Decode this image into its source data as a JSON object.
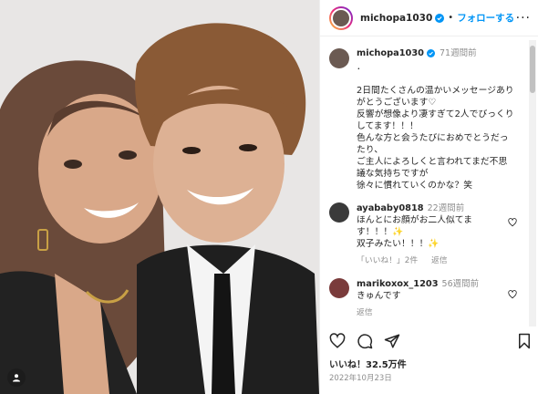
{
  "header": {
    "username": "michopa1030",
    "separator": "•",
    "follow_label": "フォローする",
    "more_label": "···"
  },
  "caption": {
    "username": "michopa1030",
    "time": "71週間前",
    "text": "．\n\n2日間たくさんの温かいメッセージあり\nがとうございます♡\n反響が想像より凄すぎて2人でびっくり\nしてます！！！\n色んな方と会うたびにおめでとうだっ\nたり、\nご主人によろしくと言われてまだ不思\n議な気持ちですが\n徐々に慣れていくのかな？笑"
  },
  "comments": [
    {
      "username": "ayababy0818",
      "time": "22週間前",
      "text": "ほんとにお顔がお二人似てま\nす！！！✨\n双子みたい！！！✨",
      "likes_label": "「いいね！」2件",
      "reply_label": "返信",
      "avatar_color": "#3a3a3a"
    },
    {
      "username": "marikoxox_1203",
      "time": "56週間前",
      "text": "きゅんです",
      "likes_label": "",
      "reply_label": "返信",
      "avatar_color": "#7a3b3b"
    }
  ],
  "footer": {
    "likes": "いいね！32.5万件",
    "date": "2022年10月23日"
  },
  "icons": {
    "like": "heart-icon",
    "comment": "comment-icon",
    "share": "share-icon",
    "save": "bookmark-icon",
    "verified": "verified-badge-icon",
    "tag": "tagged-user-icon"
  },
  "colors": {
    "follow": "#0095f6",
    "verified": "#0095f6",
    "muted": "#8e8e8e"
  }
}
